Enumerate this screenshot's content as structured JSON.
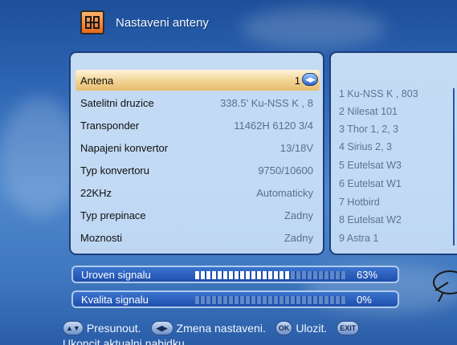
{
  "header": {
    "icon": "satellite-dish-icon",
    "title": "Nastaveni anteny"
  },
  "menu": {
    "items": [
      {
        "label": "Antena",
        "value": "1",
        "selected": true
      },
      {
        "label": "Satelitni druzice",
        "value": "338.5' Ku-NSS K , 8"
      },
      {
        "label": "Transponder",
        "value": "11462H 6120 3/4"
      },
      {
        "label": "Napajeni konvertor",
        "value": "13/18V"
      },
      {
        "label": "Typ konvertoru",
        "value": "9750/10600"
      },
      {
        "label": "22KHz",
        "value": "Automaticky"
      },
      {
        "label": "Typ prepinace",
        "value": "Zadny"
      },
      {
        "label": "Moznosti",
        "value": "Zadny"
      }
    ]
  },
  "satellite_list": [
    "1 Ku-NSS K , 803",
    "2 Nilesat 101",
    "3 Thor 1, 2, 3",
    "4 Sirius 2, 3",
    "5 Eutelsat W3",
    "6 Eutelsat W1",
    "7 Hotbird",
    "8 Eutelsat W2",
    "9 Astra 1"
  ],
  "signal": {
    "level": {
      "label": "Uroven signalu",
      "percent": "63%",
      "fraction": 0.63
    },
    "quality": {
      "label": "Kvalita signalu",
      "percent": "0%",
      "fraction": 0.0
    }
  },
  "legend": {
    "move": "Presunout.",
    "change": "Zmena nastaveni.",
    "ok_button": "OK",
    "save": "Ulozit.",
    "exit_button": "EXIT",
    "hint": "Ukoncit aktualni nabidku"
  },
  "colors": {
    "selected_row": "#f2d292",
    "panel": "#d2e6fa",
    "background": "#2d66b5"
  }
}
